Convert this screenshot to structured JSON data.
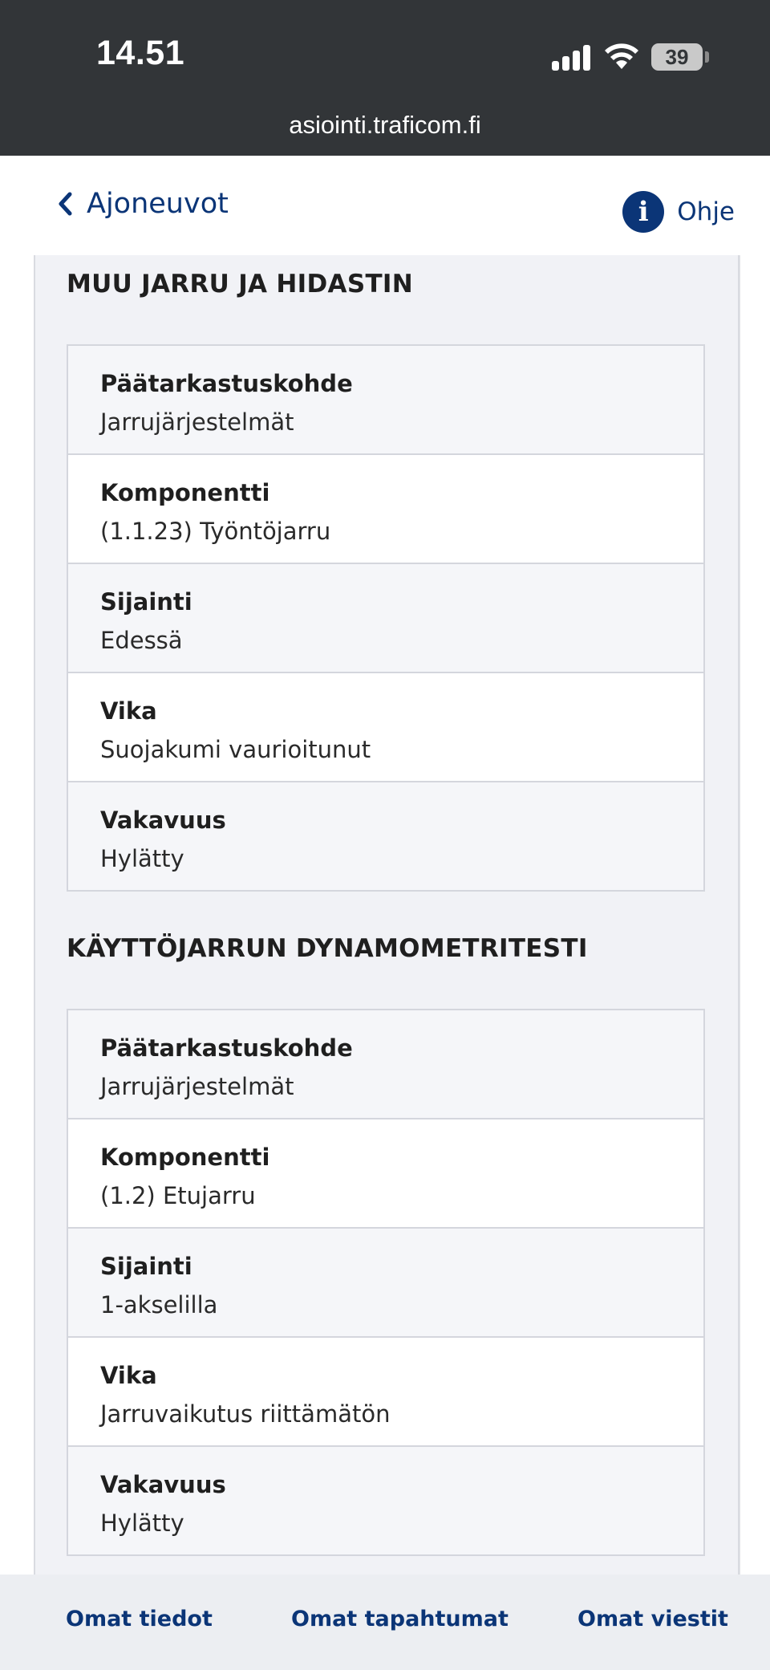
{
  "status_bar": {
    "time": "14.51",
    "battery": "39",
    "url": "asiointi.traficom.fi"
  },
  "header": {
    "back_label": "Ajoneuvot",
    "help_label": "Ohje",
    "help_icon": "i"
  },
  "sections": [
    {
      "title": "MUU JARRU JA HIDASTIN",
      "rows": [
        {
          "label": "Päätarkastuskohde",
          "value": "Jarrujärjestelmät"
        },
        {
          "label": "Komponentti",
          "value": "(1.1.23) Työntöjarru"
        },
        {
          "label": "Sijainti",
          "value": "Edessä"
        },
        {
          "label": "Vika",
          "value": "Suojakumi vaurioitunut"
        },
        {
          "label": "Vakavuus",
          "value": "Hylätty"
        }
      ]
    },
    {
      "title": "KÄYTTÖJARRUN DYNAMOMETRITESTI",
      "rows": [
        {
          "label": "Päätarkastuskohde",
          "value": "Jarrujärjestelmät"
        },
        {
          "label": "Komponentti",
          "value": "(1.2) Etujarru"
        },
        {
          "label": "Sijainti",
          "value": "1-akselilla"
        },
        {
          "label": "Vika",
          "value": "Jarruvaikutus riittämätön"
        },
        {
          "label": "Vakavuus",
          "value": "Hylätty"
        }
      ]
    }
  ],
  "bottom_nav": {
    "items": [
      "Omat tiedot",
      "Omat tapahtumat",
      "Omat viestit"
    ]
  },
  "colors": {
    "status_bar_bg": "#323538",
    "brand_blue": "#0b3577",
    "panel_bg": "#f1f2f6",
    "nav_bg": "#eceef2"
  }
}
